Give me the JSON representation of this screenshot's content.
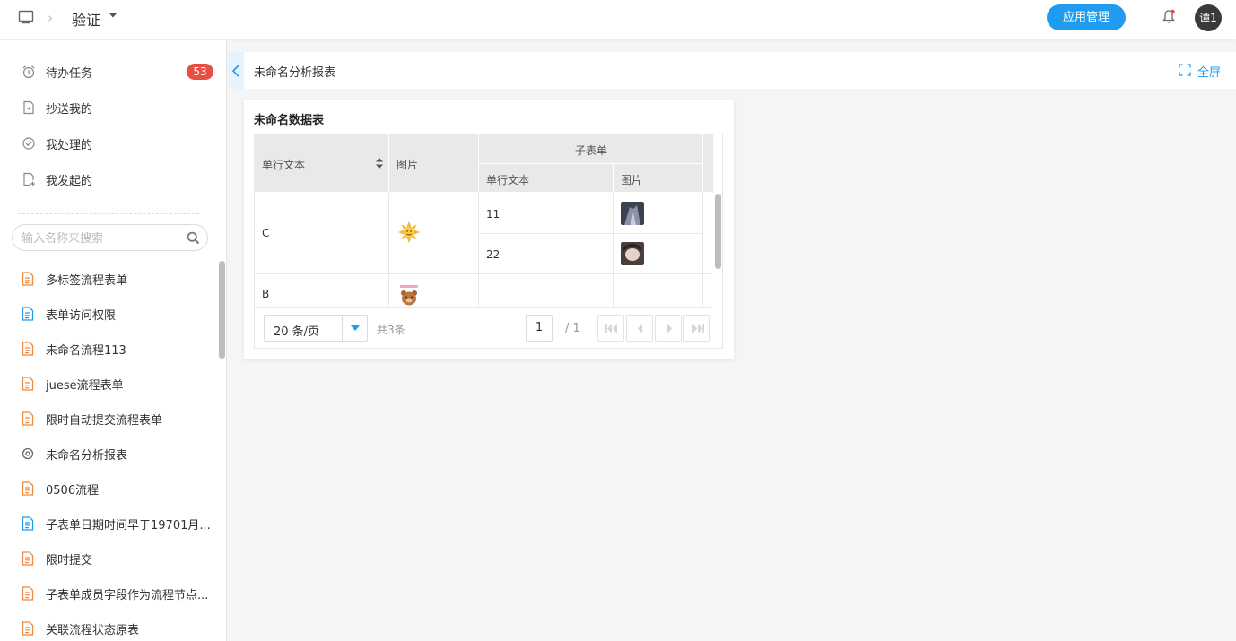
{
  "header": {
    "app_name": "验证",
    "app_manage_label": "应用管理",
    "avatar_text": "谭1",
    "icons": [
      "window-icon",
      "chevron-right-icon",
      "caret-down-icon",
      "bell-icon"
    ]
  },
  "sidebar": {
    "nav_items": [
      {
        "label": "待办任务",
        "badge": "53",
        "icon": "alarm-clock-icon"
      },
      {
        "label": "抄送我的",
        "icon": "document-send-icon"
      },
      {
        "label": "我处理的",
        "icon": "check-circle-icon"
      },
      {
        "label": "我发起的",
        "icon": "document-add-icon"
      }
    ],
    "search_placeholder": "输入名称来搜索",
    "form_items": [
      {
        "label": "多标签流程表单",
        "icon": "flow-form-icon",
        "color": "#f0873a"
      },
      {
        "label": "表单访问权限",
        "icon": "form-icon",
        "color": "#1f9cf0"
      },
      {
        "label": "未命名流程113",
        "icon": "flow-form-icon",
        "color": "#f0873a"
      },
      {
        "label": "juese流程表单",
        "icon": "flow-form-icon",
        "color": "#f0873a"
      },
      {
        "label": "限时自动提交流程表单",
        "icon": "flow-form-icon",
        "color": "#f0873a"
      },
      {
        "label": "未命名分析报表",
        "icon": "report-icon",
        "color": "#666666"
      },
      {
        "label": "0506流程",
        "icon": "flow-form-icon",
        "color": "#f0873a"
      },
      {
        "label": "子表单日期时间早于19701月...",
        "icon": "form-icon",
        "color": "#1f9cf0"
      },
      {
        "label": "限时提交",
        "icon": "flow-form-icon",
        "color": "#f0873a"
      },
      {
        "label": "子表单成员字段作为流程节点...",
        "icon": "flow-form-icon",
        "color": "#f0873a"
      },
      {
        "label": "关联流程状态原表",
        "icon": "flow-form-icon",
        "color": "#f0873a"
      }
    ]
  },
  "content": {
    "report_title": "未命名分析报表",
    "fullscreen_label": "全屏"
  },
  "card": {
    "title": "未命名数据表",
    "columns": {
      "text": "单行文本",
      "image": "图片",
      "subform": "子表单",
      "sub_text": "单行文本",
      "sub_image": "图片"
    },
    "rows": [
      {
        "text": "C",
        "image": "sun-sticker",
        "subrows": [
          {
            "text": "11",
            "image": "building-photo"
          },
          {
            "text": "22",
            "image": "portrait-photo"
          }
        ]
      },
      {
        "text": "B",
        "image": "bear-sticker",
        "subrows": [
          {
            "text": "",
            "image": ""
          }
        ]
      }
    ],
    "pager": {
      "page_size": "20 条/页",
      "total": "共3条",
      "current_page": "1",
      "page_total": "/ 1"
    }
  },
  "colors": {
    "accent": "#1f9cf0",
    "badge": "#e94e44",
    "orange_icon": "#f0873a"
  }
}
